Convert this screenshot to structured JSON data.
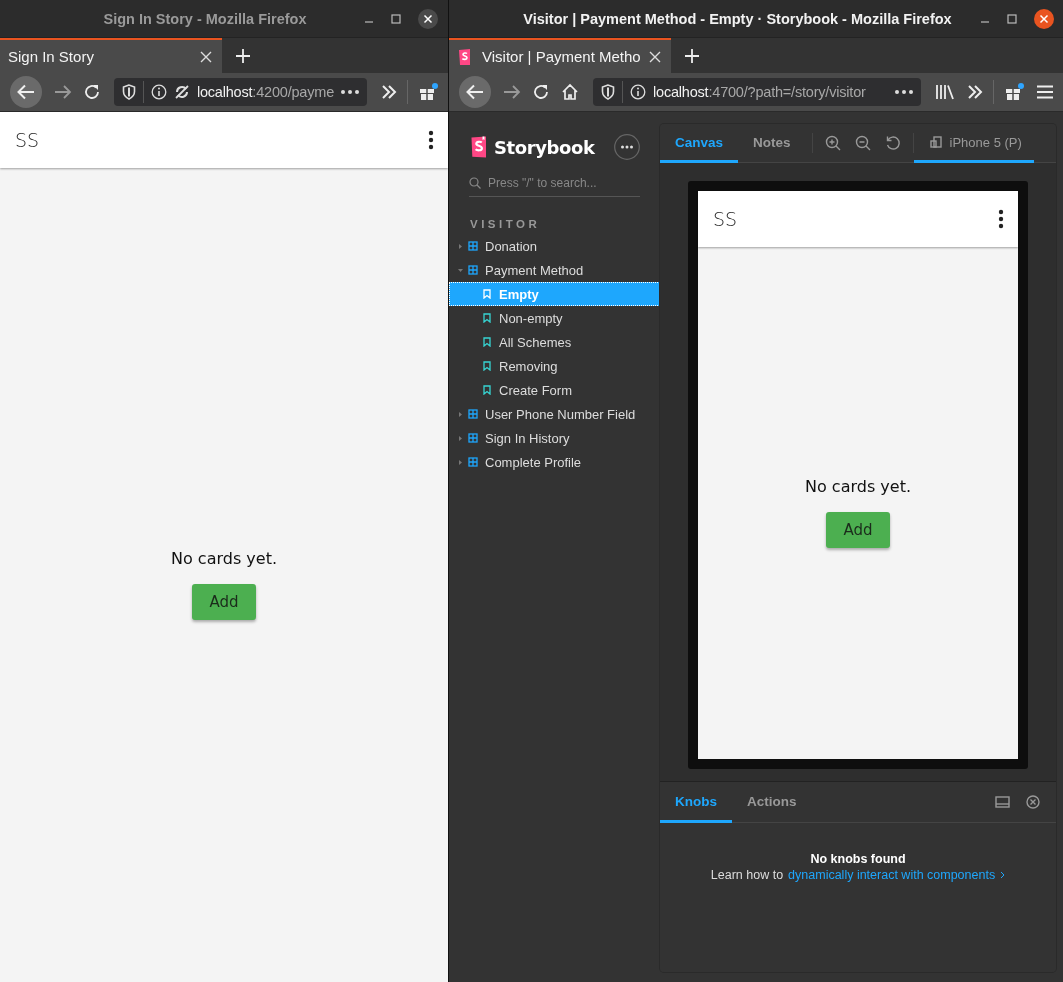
{
  "windows": [
    {
      "kind": "app",
      "focused": false,
      "title": "Sign In Story - Mozilla Firefox",
      "tabs": [
        {
          "label": "Sign In Story",
          "favicon": false,
          "selected": true
        }
      ],
      "url": {
        "host": "localhost",
        "path": ":4200/payme"
      },
      "tracking_off": true,
      "home_button": false,
      "library_button": false,
      "menu_button": false,
      "app": {
        "brand": "SS",
        "message": "No cards yet.",
        "button": "Add"
      }
    },
    {
      "kind": "storybook",
      "focused": true,
      "title": "Visitor | Payment Method - Empty · Storybook - Mozilla Firefox",
      "tabs": [
        {
          "label": "Visitor | Payment Metho",
          "favicon": true,
          "selected": true
        }
      ],
      "url": {
        "host": "localhost",
        "path": ":4700/?path=/story/visitor"
      },
      "tracking_off": false,
      "home_button": true,
      "library_button": true,
      "menu_button": true,
      "storybook": {
        "brand": "Storybook",
        "search": {
          "placeholder": "Press \"/\" to search..."
        },
        "section": "VISITOR",
        "tree": [
          {
            "label": "Donation",
            "expanded": false
          },
          {
            "label": "Payment Method",
            "expanded": true,
            "children": [
              {
                "label": "Empty",
                "selected": true
              },
              {
                "label": "Non-empty",
                "selected": false
              },
              {
                "label": "All Schemes",
                "selected": false
              },
              {
                "label": "Removing",
                "selected": false
              },
              {
                "label": "Create Form",
                "selected": false
              }
            ]
          },
          {
            "label": "User Phone Number Field",
            "expanded": false
          },
          {
            "label": "Sign In History",
            "expanded": false
          },
          {
            "label": "Complete Profile",
            "expanded": false
          }
        ],
        "preview_tabs": [
          {
            "label": "Canvas",
            "selected": true
          },
          {
            "label": "Notes",
            "selected": false
          }
        ],
        "device": {
          "label": "iPhone 5 (P)",
          "selected": true
        },
        "app": {
          "brand": "SS",
          "message": "No cards yet.",
          "button": "Add"
        },
        "addon_tabs": [
          {
            "label": "Knobs",
            "selected": true
          },
          {
            "label": "Actions",
            "selected": false
          }
        ],
        "empty": {
          "title": "No knobs found",
          "text": "Learn how to",
          "link": "dynamically interact with components"
        }
      }
    }
  ]
}
